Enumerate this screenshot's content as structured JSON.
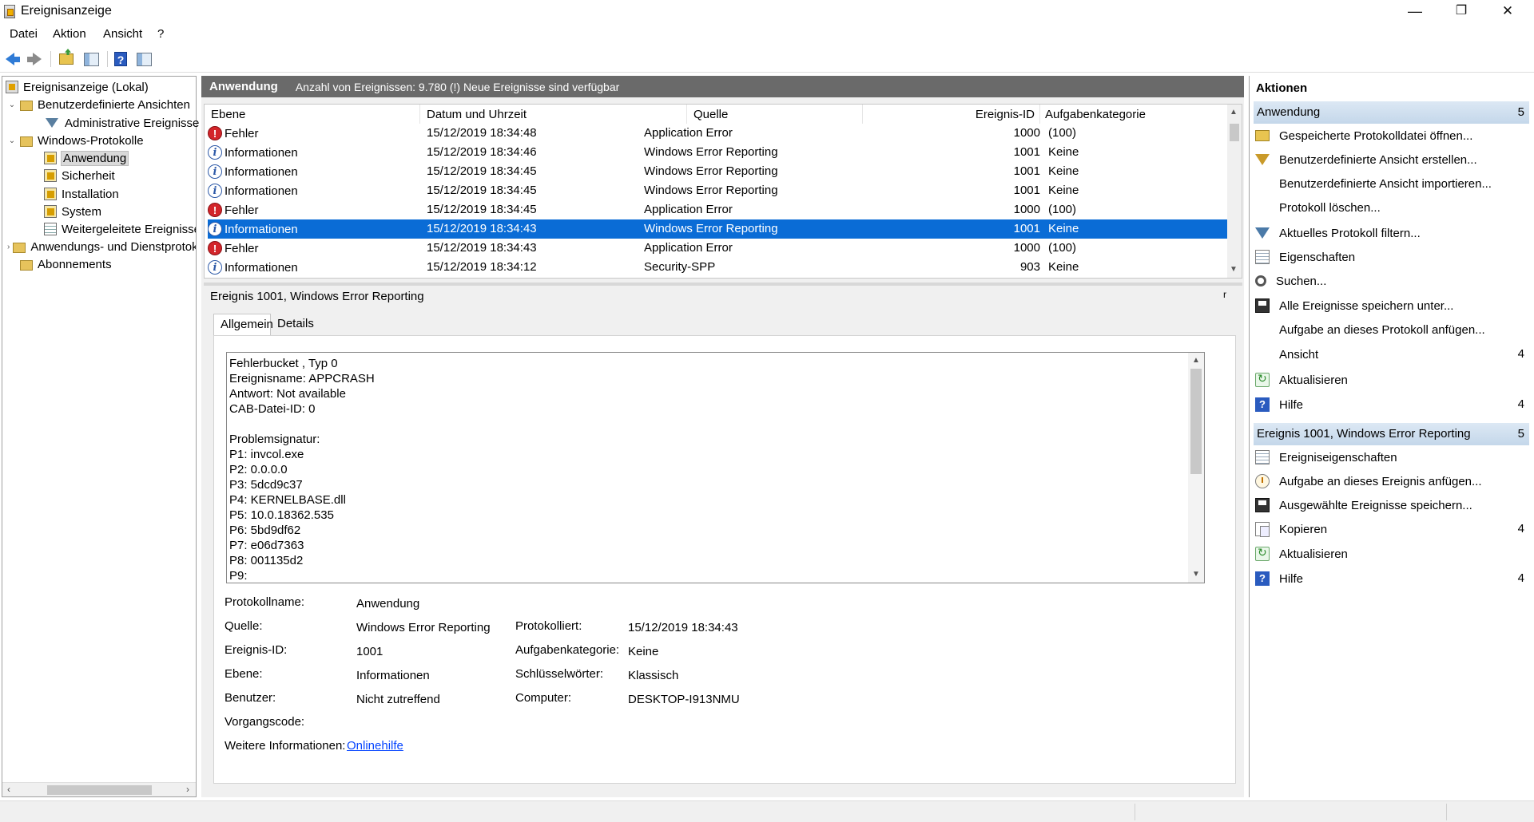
{
  "window": {
    "title": "Ereignisanzeige",
    "minimize": "—",
    "maximize": "❐",
    "close": "✕"
  },
  "menu": [
    "Datei",
    "Aktion",
    "Ansicht",
    "?"
  ],
  "tree": {
    "root": "Ereignisanzeige (Lokal)",
    "custom_views": "Benutzerdefinierte Ansichten",
    "admin_events": "Administrative Ereignisse",
    "windows_logs": "Windows-Protokolle",
    "application": "Anwendung",
    "security": "Sicherheit",
    "setup": "Installation",
    "system": "System",
    "forwarded": "Weitergeleitete Ereignisse",
    "app_services": "Anwendungs- und Dienstprotokolle",
    "subscriptions": "Abonnements"
  },
  "center": {
    "header_name": "Anwendung",
    "header_info": "Anzahl von Ereignissen: 9.780 (!) Neue Ereignisse sind verfügbar",
    "columns": [
      "Ebene",
      "Datum und Uhrzeit",
      "Quelle",
      "Ereignis-ID",
      "Aufgabenkategorie"
    ],
    "rows": [
      {
        "level": "Fehler",
        "type": "err",
        "date": "15/12/2019 18:34:48",
        "source": "Application Error",
        "id": "1000",
        "cat": "(100)"
      },
      {
        "level": "Informationen",
        "type": "inf",
        "date": "15/12/2019 18:34:46",
        "source": "Windows Error Reporting",
        "id": "1001",
        "cat": "Keine"
      },
      {
        "level": "Informationen",
        "type": "inf",
        "date": "15/12/2019 18:34:45",
        "source": "Windows Error Reporting",
        "id": "1001",
        "cat": "Keine"
      },
      {
        "level": "Informationen",
        "type": "inf",
        "date": "15/12/2019 18:34:45",
        "source": "Windows Error Reporting",
        "id": "1001",
        "cat": "Keine"
      },
      {
        "level": "Fehler",
        "type": "err",
        "date": "15/12/2019 18:34:45",
        "source": "Application Error",
        "id": "1000",
        "cat": "(100)"
      },
      {
        "level": "Informationen",
        "type": "inf",
        "date": "15/12/2019 18:34:43",
        "source": "Windows Error Reporting",
        "id": "1001",
        "cat": "Keine",
        "selected": true
      },
      {
        "level": "Fehler",
        "type": "err",
        "date": "15/12/2019 18:34:43",
        "source": "Application Error",
        "id": "1000",
        "cat": "(100)"
      },
      {
        "level": "Informationen",
        "type": "inf",
        "date": "15/12/2019 18:34:12",
        "source": "Security-SPP",
        "id": "903",
        "cat": "Keine"
      }
    ]
  },
  "detail": {
    "title": "Ereignis 1001, Windows Error Reporting",
    "close_glyph": "r",
    "tabs": [
      "Allgemein",
      "Details"
    ],
    "description": "Fehlerbucket , Typ 0\nEreignisname: APPCRASH\nAntwort: Not available\nCAB-Datei-ID: 0\n\nProblemsignatur:\nP1: invcol.exe\nP2: 0.0.0.0\nP3: 5dcd9c37\nP4: KERNELBASE.dll\nP5: 10.0.18362.535\nP6: 5bd9df62\nP7: e06d7363\nP8: 001135d2\nP9:",
    "fields": {
      "log_name_label": "Protokollname:",
      "log_name": "Anwendung",
      "source_label": "Quelle:",
      "source": "Windows Error Reporting",
      "logged_label": "Protokolliert:",
      "logged": "15/12/2019 18:34:43",
      "event_id_label": "Ereignis-ID:",
      "event_id": "1001",
      "task_label": "Aufgabenkategorie:",
      "task": "Keine",
      "level_label": "Ebene:",
      "level": "Informationen",
      "keywords_label": "Schlüsselwörter:",
      "keywords": "Klassisch",
      "user_label": "Benutzer:",
      "user": "Nicht zutreffend",
      "computer_label": "Computer:",
      "computer": "DESKTOP-I913NMU",
      "opcode_label": "Vorgangscode:",
      "more_info_label": "Weitere Informationen:",
      "more_info_link": "Onlinehilfe"
    }
  },
  "actions": {
    "header": "Aktionen",
    "section1": {
      "title": "Anwendung",
      "arrow": "5"
    },
    "items1": [
      {
        "label": "Gespeicherte Protokolldatei öffnen...",
        "icon": "folder-icon"
      },
      {
        "label": "Benutzerdefinierte Ansicht erstellen...",
        "icon": "filter-icon"
      },
      {
        "label": "Benutzerdefinierte Ansicht importieren...",
        "icon": ""
      },
      {
        "label": "Protokoll löschen...",
        "icon": ""
      },
      {
        "label": "Aktuelles Protokoll filtern...",
        "icon": "filter-icon"
      },
      {
        "label": "Eigenschaften",
        "icon": "properties-icon"
      },
      {
        "label": "Suchen...",
        "icon": "find-icon"
      },
      {
        "label": "Alle Ereignisse speichern unter...",
        "icon": "save-icon"
      },
      {
        "label": "Aufgabe an dieses Protokoll anfügen...",
        "icon": ""
      },
      {
        "label": "Ansicht",
        "icon": "",
        "arrow": "4"
      },
      {
        "label": "Aktualisieren",
        "icon": "refresh-icon"
      },
      {
        "label": "Hilfe",
        "icon": "help-icon",
        "arrow": "4"
      }
    ],
    "section2": {
      "title": "Ereignis 1001, Windows Error Reporting",
      "arrow": "5"
    },
    "items2": [
      {
        "label": "Ereigniseigenschaften",
        "icon": "properties-icon"
      },
      {
        "label": "Aufgabe an dieses Ereignis anfügen...",
        "icon": "task-icon"
      },
      {
        "label": "Ausgewählte Ereignisse speichern...",
        "icon": "save-icon"
      },
      {
        "label": "Kopieren",
        "icon": "copy-icon",
        "arrow": "4"
      },
      {
        "label": "Aktualisieren",
        "icon": "refresh-icon"
      },
      {
        "label": "Hilfe",
        "icon": "help-icon",
        "arrow": "4"
      }
    ]
  }
}
